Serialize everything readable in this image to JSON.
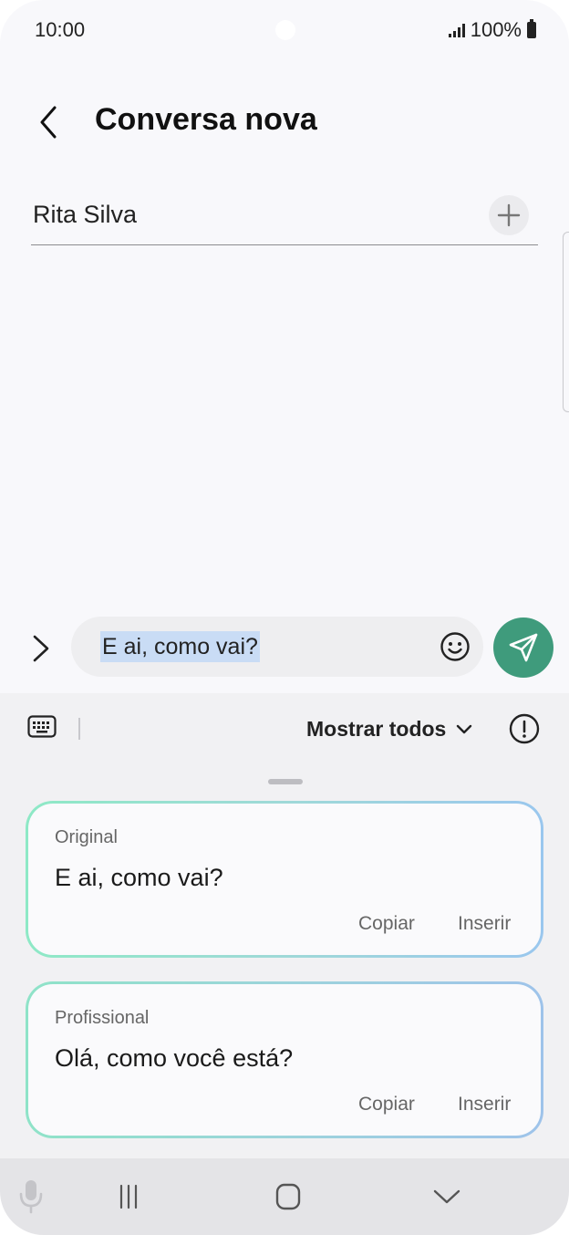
{
  "status_bar": {
    "time": "10:00",
    "battery": "100%"
  },
  "header": {
    "title": "Conversa nova",
    "back_icon": "chevron-left-icon"
  },
  "recipient": {
    "name": "Rita Silva",
    "add_icon": "plus-icon"
  },
  "composer": {
    "expand_icon": "chevron-right-icon",
    "message_text": "E ai, como vai?",
    "emoji_icon": "smiley-icon",
    "send_icon": "send-icon"
  },
  "suggestions_panel": {
    "keyboard_icon": "keyboard-icon",
    "filter_label": "Mostrar todos",
    "filter_icon": "chevron-down-icon",
    "info_icon": "exclamation-circle-icon",
    "cards": [
      {
        "label": "Original",
        "text": "E ai, como vai?",
        "copy_label": "Copiar",
        "insert_label": "Inserir"
      },
      {
        "label": "Profissional",
        "text": "Olá, como você está?",
        "copy_label": "Copiar",
        "insert_label": "Inserir"
      }
    ]
  },
  "nav_bar": {
    "items": [
      "microphone-icon",
      "recents-icon",
      "home-icon",
      "hide-keyboard-icon"
    ]
  },
  "colors": {
    "send_button": "#3f9b7c",
    "selection_highlight": "#c9dcf5",
    "card_gradient_start": "#8ee9c6",
    "card_gradient_end": "#9ac7ee"
  }
}
